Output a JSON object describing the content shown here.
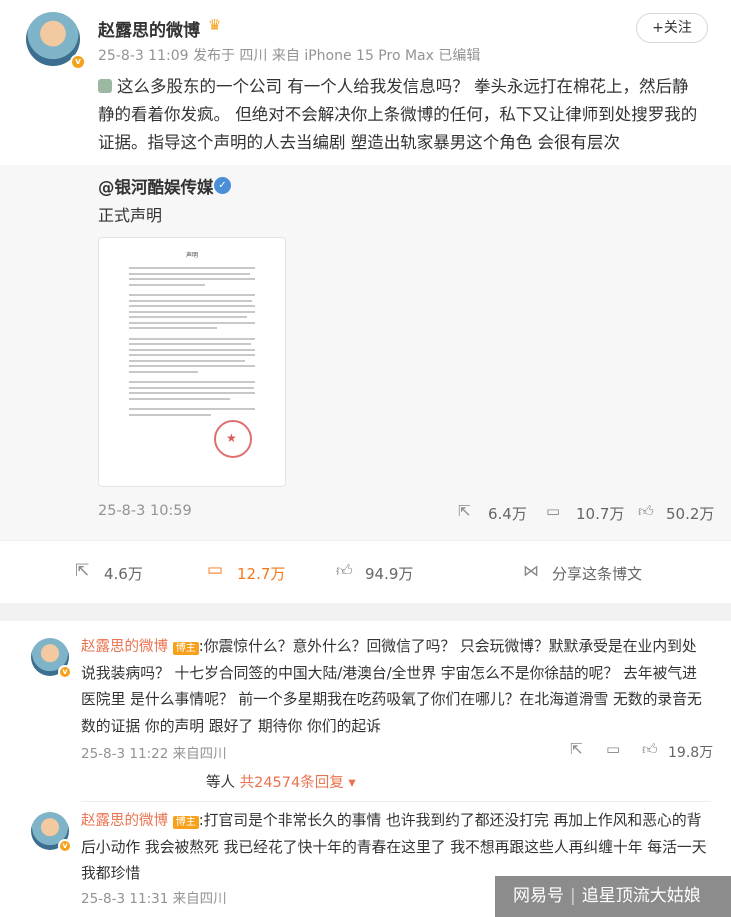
{
  "post": {
    "author": "赵露思的微博",
    "crown": "♛",
    "follow_label": "+关注",
    "meta": "25-8-3 11:09  发布于 四川  来自 iPhone 15 Pro Max  已编辑",
    "text": "这么多股东的一个公司 有一个人给我发信息吗？ 拳头永远打在棉花上，然后静静的看着你发疯。 但绝对不会解决你上条微博的任何，私下又让律师到处搜罗我的证据。指导这个声明的人去当编剧 塑造出轨家暴男这个角色 会很有层次"
  },
  "repost": {
    "author": "@银河酷娱传媒",
    "text": "正式声明",
    "doc_title": "声明",
    "time": "25-8-3 10:59",
    "shares": "6.4万",
    "comments": "10.7万",
    "likes": "50.2万"
  },
  "actions": {
    "shares": "4.6万",
    "comments": "12.7万",
    "likes": "94.9万",
    "share_label": "分享这条博文"
  },
  "comments": [
    {
      "author": "赵露思的微博",
      "tag": "博主",
      "text": ":你震惊什么？意外什么？回微信了吗？ 只会玩微博？默默承受是在业内到处说我装病吗？ 十七岁合同签的中国大陆/港澳台/全世界  宇宙怎么不是你徐喆的呢？  去年被气进医院里 是什么事情呢？  前一个多星期我在吃药吸氧了你们在哪儿？在北海道滑雪 无数的录音无数的证据 你的声明 跟好了 期待你 你们的起诉",
      "meta": "25-8-3 11:22  来自四川",
      "likes": "19.8万"
    },
    {
      "author": "赵露思的微博",
      "tag": "博主",
      "text": ":打官司是个非常长久的事情 也许我到约了都还没打完 再加上作风和恶心的背后小动作 我会被熬死 我已经花了快十年的青春在这里了 我不想再跟这些人再纠缠十年 每活一天我都珍惜",
      "meta": "25-8-3 11:31  来自四川"
    }
  ],
  "replies": {
    "prefix": "等人",
    "link": "共24574条回复",
    "arrow": "▾"
  },
  "watermark": {
    "brand": "网易号",
    "sep": "|",
    "account": "追星顶流大姑娘"
  }
}
